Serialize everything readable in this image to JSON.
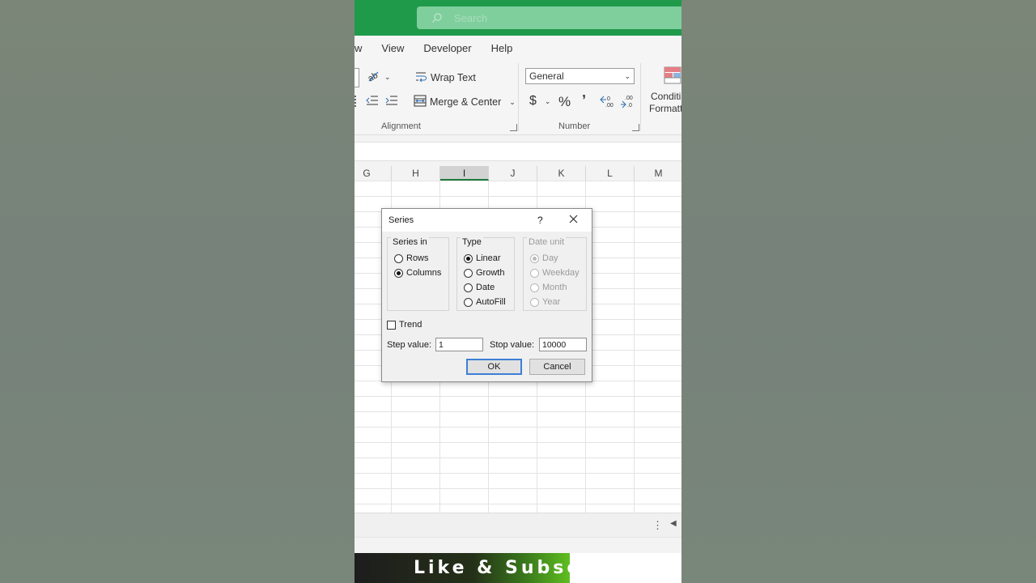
{
  "search": {
    "placeholder": "Search"
  },
  "ribbon_tabs": [
    "w",
    "View",
    "Developer",
    "Help"
  ],
  "ribbon": {
    "wrap_text": "Wrap Text",
    "merge_center": "Merge & Center",
    "alignment_label": "Alignment",
    "number_format": "General",
    "currency": "$",
    "percent": "%",
    "comma": "ʼ",
    "number_label": "Number",
    "cond_format_line1": "Conditi",
    "cond_format_line2": "Formatt"
  },
  "columns": [
    "G",
    "H",
    "I",
    "J",
    "K",
    "L",
    "M"
  ],
  "selected_column": "I",
  "dialog": {
    "title": "Series",
    "help": "?",
    "series_in": {
      "label": "Series in",
      "options": [
        "Rows",
        "Columns"
      ],
      "selected": "Columns"
    },
    "type": {
      "label": "Type",
      "options": [
        "Linear",
        "Growth",
        "Date",
        "AutoFill"
      ],
      "selected": "Linear"
    },
    "date_unit": {
      "label": "Date unit",
      "options": [
        "Day",
        "Weekday",
        "Month",
        "Year"
      ],
      "selected": "Day"
    },
    "trend_label": "Trend",
    "step_label": "Step value:",
    "step_value": "1",
    "stop_label": "Stop value:",
    "stop_value": "10000",
    "ok": "OK",
    "cancel": "Cancel"
  },
  "banner_text": "Like & Subsc"
}
